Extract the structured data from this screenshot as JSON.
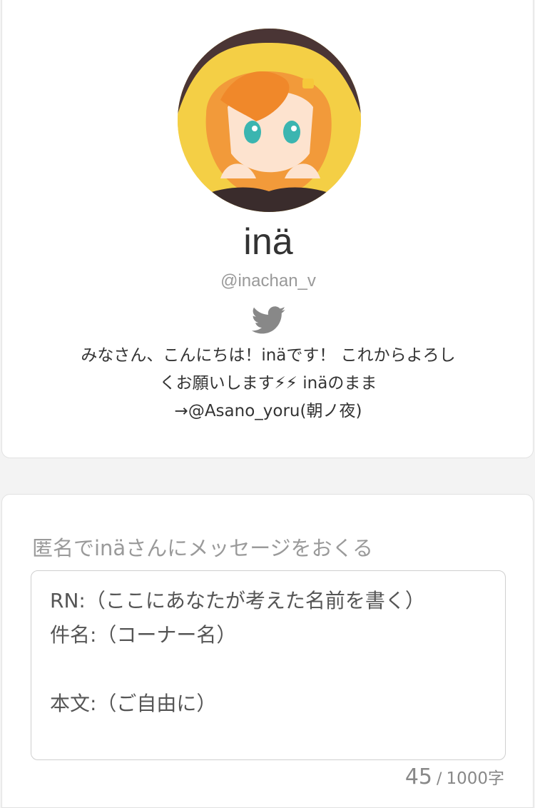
{
  "profile": {
    "display_name": "inä",
    "handle": "@inachan_v",
    "bio_lines": [
      "みなさん、こんにちは！inäです！ これからよろし",
      "くお願いします⚡⚡ inäのまま",
      "→@Asano_yoru(朝ノ夜)"
    ]
  },
  "message_form": {
    "title": "匿名でinäさんにメッセージをおくる",
    "body": "RN:（ここにあなたが考えた名前を書く）\n件名:（コーナー名）\n\n本文:（ご自由に）",
    "char_count": "45",
    "separator": "/",
    "char_limit": "1000字"
  },
  "colors": {
    "background": "#f3f3f3",
    "card": "#ffffff",
    "twitter_icon": "#888888",
    "accent_bolt": "#f5b400"
  }
}
